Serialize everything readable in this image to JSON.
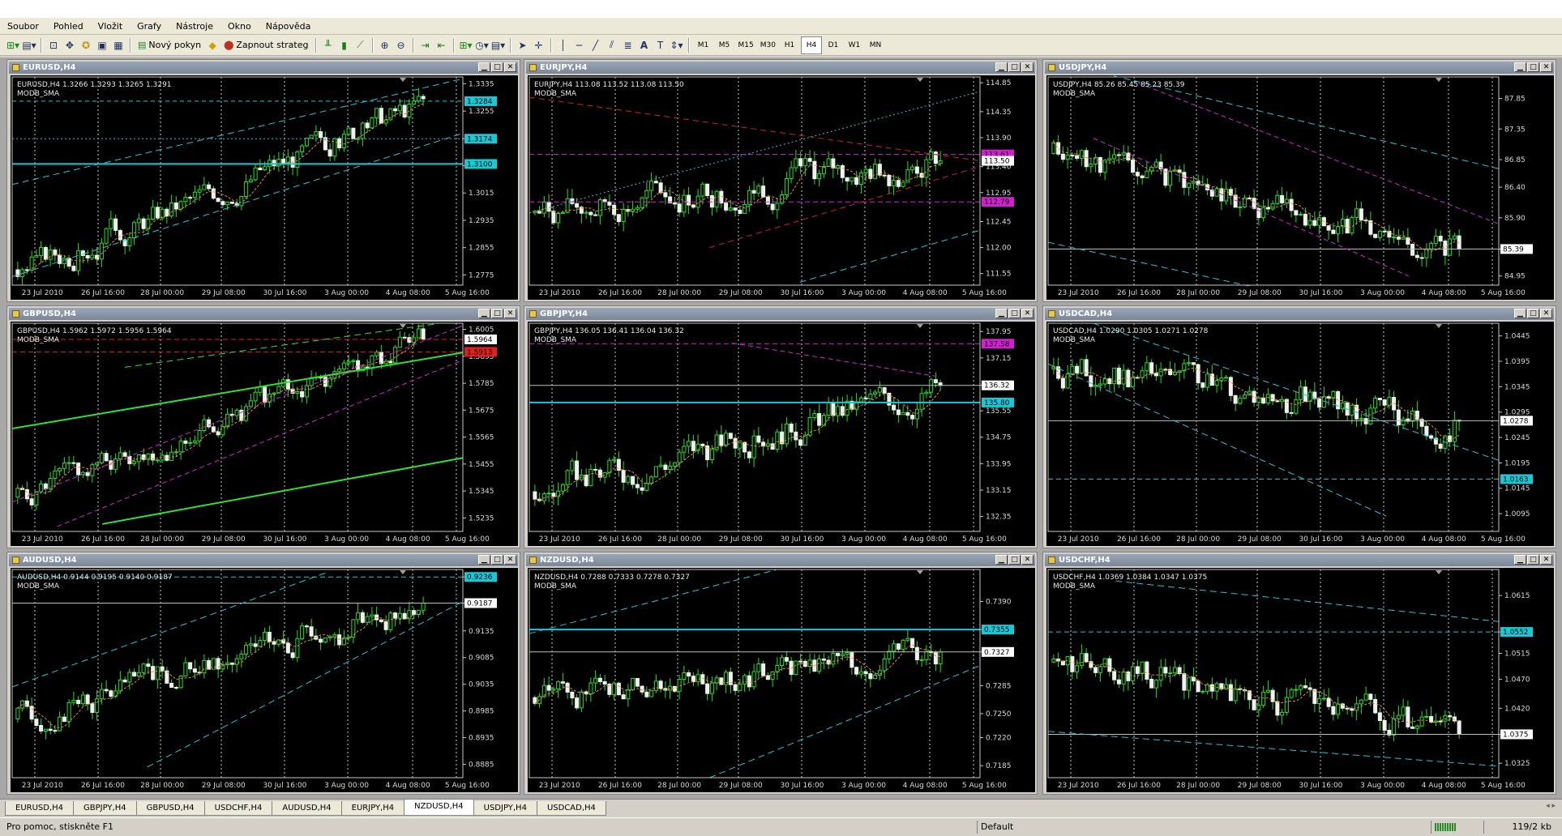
{
  "menu": [
    "Soubor",
    "Pohled",
    "Vložit",
    "Grafy",
    "Nástroje",
    "Okno",
    "Nápověda"
  ],
  "toolbar": {
    "new_order": "Nový pokyn",
    "autotrading": "Zapnout strateg",
    "timeframes": [
      "M1",
      "M5",
      "M15",
      "M30",
      "H1",
      "H4",
      "D1",
      "W1",
      "MN"
    ],
    "active_timeframe": "H4"
  },
  "x_labels": [
    "23 Jul 2010",
    "26 Jul 16:00",
    "28 Jul 00:00",
    "29 Jul 08:00",
    "30 Jul 16:00",
    "3 Aug 00:00",
    "4 Aug 08:00",
    "5 Aug 16:00"
  ],
  "tabs": [
    "EURUSD,H4",
    "GBPJPY,H4",
    "GBPUSD,H4",
    "USDCHF,H4",
    "AUDUSD,H4",
    "EURJPY,H4",
    "NZDUSD,H4",
    "USDJPY,H4",
    "USDCAD,H4"
  ],
  "active_tab": "NZDUSD,H4",
  "status": {
    "help": "Pro pomoc, stiskněte F1",
    "profile": "Default",
    "traffic": "119/2 kb"
  },
  "charts": [
    {
      "title": "EURUSD,H4",
      "info": "EURUSD,H4  1.3266 1.3293 1.3265 1.3291",
      "indicator": "MODB_SMA",
      "ymin": 1.2745,
      "ymax": 1.3355,
      "ticks": [
        "1.3335",
        "1.3255",
        "1.3174",
        "1.3095",
        "1.3015",
        "1.2935",
        "1.2855",
        "1.2775"
      ],
      "start": 1.279,
      "end": 1.3291,
      "vol": 0.0032,
      "seed": 3,
      "lines": [
        {
          "p": [
            [
              0,
              1.3284
            ],
            [
              1,
              1.3284
            ]
          ],
          "c": "#19c8d4",
          "d": "5,4"
        },
        {
          "p": [
            [
              0,
              1.3174
            ],
            [
              1,
              1.3174
            ]
          ],
          "c": "#19c8d4",
          "d": "2,3"
        },
        {
          "p": [
            [
              0,
              1.31
            ],
            [
              1,
              1.31
            ]
          ],
          "c": "#19c8d4",
          "d": "",
          "w": 2
        },
        {
          "p": [
            [
              0,
              1.304
            ],
            [
              1,
              1.335
            ]
          ],
          "c": "#19c8d4",
          "d": "8,5"
        },
        {
          "p": [
            [
              0,
              1.277
            ],
            [
              1,
              1.319
            ]
          ],
          "c": "#19c8d4",
          "d": "8,5"
        }
      ],
      "labels": [
        {
          "t": "1.3284",
          "bg": "#19c8d4"
        },
        {
          "t": "1.3174",
          "bg": "#19c8d4"
        },
        {
          "t": "1.3100",
          "bg": "#19c8d4"
        }
      ]
    },
    {
      "title": "EURJPY,H4",
      "info": "EURJPY,H4  113.08 113.52 113.08 113.50",
      "indicator": "MODB_SMA",
      "ymin": 111.35,
      "ymax": 114.95,
      "ticks": [
        "114.85",
        "114.35",
        "113.90",
        "113.40",
        "112.95",
        "112.45",
        "112.00",
        "111.55"
      ],
      "start": 112.6,
      "end": 113.5,
      "vol": 0.22,
      "seed": 7,
      "lines": [
        {
          "p": [
            [
              0,
              113.61
            ],
            [
              1,
              113.61
            ]
          ],
          "c": "#d020d0",
          "d": "6,4"
        },
        {
          "p": [
            [
              0,
              112.79
            ],
            [
              1,
              112.79
            ]
          ],
          "c": "#d020d0",
          "d": "6,4"
        },
        {
          "p": [
            [
              0,
              114.6
            ],
            [
              1,
              113.5
            ]
          ],
          "c": "#d02020",
          "d": "7,5"
        },
        {
          "p": [
            [
              0.4,
              112.0
            ],
            [
              1,
              113.4
            ]
          ],
          "c": "#d02020",
          "d": "7,5"
        },
        {
          "p": [
            [
              0,
              112.6
            ],
            [
              1,
              114.7
            ]
          ],
          "c": "#19c8d4",
          "d": "2,3"
        },
        {
          "p": [
            [
              0.6,
              111.4
            ],
            [
              1,
              112.3
            ]
          ],
          "c": "#19c8d4",
          "d": "8,5"
        }
      ],
      "labels": [
        {
          "t": "113.61",
          "bg": "#d020d0"
        },
        {
          "t": "113.50",
          "bg": "#ffffff"
        },
        {
          "t": "112.79",
          "bg": "#d020d0"
        }
      ]
    },
    {
      "title": "USDJPY,H4",
      "info": "USDJPY,H4  85.26 85.45 85.23 85.39",
      "indicator": "MODB_SMA",
      "ymin": 84.8,
      "ymax": 88.2,
      "ticks": [
        "87.85",
        "87.35",
        "86.85",
        "86.40",
        "85.90",
        "85.39",
        "84.95"
      ],
      "start": 86.95,
      "end": 85.39,
      "vol": 0.2,
      "seed": 11,
      "lines": [
        {
          "p": [
            [
              0,
              85.39
            ],
            [
              1,
              85.39
            ]
          ],
          "c": "#c0c0c0",
          "d": ""
        },
        {
          "p": [
            [
              0.2,
              88.1
            ],
            [
              1,
              85.8
            ]
          ],
          "c": "#d020d0",
          "d": "6,4"
        },
        {
          "p": [
            [
              0.1,
              87.2
            ],
            [
              0.8,
              84.95
            ]
          ],
          "c": "#d020d0",
          "d": "6,4"
        },
        {
          "p": [
            [
              0.1,
              88.3
            ],
            [
              1,
              86.7
            ]
          ],
          "c": "#19c8d4",
          "d": "8,5"
        },
        {
          "p": [
            [
              0,
              85.5
            ],
            [
              0.5,
              84.7
            ]
          ],
          "c": "#19c8d4",
          "d": "8,5"
        }
      ],
      "labels": [
        {
          "t": "85.39",
          "bg": "#ffffff"
        }
      ]
    },
    {
      "title": "GBPUSD,H4",
      "info": "GBPUSD,H4  1.5962 1.5972 1.5956 1.5964",
      "indicator": "MODB_SMA",
      "ymin": 1.518,
      "ymax": 1.603,
      "ticks": [
        "1.6005",
        "1.5895",
        "1.5785",
        "1.5675",
        "1.5565",
        "1.5455",
        "1.5345",
        "1.5235"
      ],
      "start": 1.532,
      "end": 1.5964,
      "vol": 0.0042,
      "seed": 5,
      "lines": [
        {
          "p": [
            [
              0,
              1.5964
            ],
            [
              1,
              1.5964
            ]
          ],
          "c": "#e02020",
          "d": "6,4"
        },
        {
          "p": [
            [
              0,
              1.5913
            ],
            [
              1,
              1.5913
            ]
          ],
          "c": "#e02020",
          "d": "6,4"
        },
        {
          "p": [
            [
              0,
              1.56
            ],
            [
              1,
              1.591
            ]
          ],
          "c": "#30e030",
          "d": "",
          "w": 2
        },
        {
          "p": [
            [
              0.2,
              1.521
            ],
            [
              1,
              1.548
            ]
          ],
          "c": "#30e030",
          "d": "",
          "w": 2
        },
        {
          "p": [
            [
              0.25,
              1.585
            ],
            [
              0.95,
              1.603
            ]
          ],
          "c": "#30e030",
          "d": "8,5"
        },
        {
          "p": [
            [
              0,
              1.53
            ],
            [
              1,
              1.602
            ]
          ],
          "c": "#d020d0",
          "d": "6,4"
        },
        {
          "p": [
            [
              0.1,
              1.52
            ],
            [
              1,
              1.588
            ]
          ],
          "c": "#d020d0",
          "d": "6,4"
        }
      ],
      "labels": [
        {
          "t": "1.5964",
          "bg": "#ffffff"
        },
        {
          "t": "1.5913",
          "bg": "#e02020"
        }
      ]
    },
    {
      "title": "GBPJPY,H4",
      "info": "GBPJPY,H4  136.05 136.41 136.04 136.32",
      "indicator": "MODB_SMA",
      "ymin": 131.9,
      "ymax": 138.2,
      "ticks": [
        "137.95",
        "137.15",
        "136.32",
        "135.55",
        "134.75",
        "133.95",
        "133.15",
        "132.35"
      ],
      "start": 133.1,
      "end": 136.32,
      "vol": 0.38,
      "seed": 9,
      "lines": [
        {
          "p": [
            [
              0,
              137.58
            ],
            [
              1,
              137.58
            ]
          ],
          "c": "#d020d0",
          "d": "6,4"
        },
        {
          "p": [
            [
              0,
              135.8
            ],
            [
              1,
              135.8
            ]
          ],
          "c": "#19c8d4",
          "d": "",
          "w": 2
        },
        {
          "p": [
            [
              0,
              136.32
            ],
            [
              1,
              136.32
            ]
          ],
          "c": "#c0c0c0",
          "d": ""
        },
        {
          "p": [
            [
              0.45,
              137.6
            ],
            [
              0.9,
              136.6
            ]
          ],
          "c": "#d020d0",
          "d": "6,4"
        }
      ],
      "labels": [
        {
          "t": "137.58",
          "bg": "#d020d0"
        },
        {
          "t": "136.32",
          "bg": "#ffffff"
        },
        {
          "t": "135.80",
          "bg": "#19c8d4"
        }
      ]
    },
    {
      "title": "USDCAD,H4",
      "info": "USDCAD,H4  1.0290 1.0305 1.0271 1.0278",
      "indicator": "MODB_SMA",
      "ymin": 1.006,
      "ymax": 1.047,
      "ticks": [
        "1.0445",
        "1.0395",
        "1.0345",
        "1.0295",
        "1.0245",
        "1.0195",
        "1.0145",
        "1.0095"
      ],
      "start": 1.038,
      "end": 1.0278,
      "vol": 0.0025,
      "seed": 13,
      "lines": [
        {
          "p": [
            [
              0,
              1.0278
            ],
            [
              1,
              1.0278
            ]
          ],
          "c": "#c0c0c0",
          "d": ""
        },
        {
          "p": [
            [
              0,
              1.0163
            ],
            [
              1,
              1.0163
            ]
          ],
          "c": "#19c8d4",
          "d": "6,4"
        },
        {
          "p": [
            [
              0.1,
              1.047
            ],
            [
              1,
              1.02
            ]
          ],
          "c": "#19c8d4",
          "d": "8,5"
        },
        {
          "p": [
            [
              0,
              1.039
            ],
            [
              0.75,
              1.009
            ]
          ],
          "c": "#19c8d4",
          "d": "8,5"
        }
      ],
      "labels": [
        {
          "t": "1.0278",
          "bg": "#ffffff"
        },
        {
          "t": "1.0163",
          "bg": "#19c8d4"
        }
      ]
    },
    {
      "title": "AUDUSD,H4",
      "info": "AUDUSD,H4  0.9144 0.9195 0.9140 0.9187",
      "indicator": "MODB_SMA",
      "ymin": 0.886,
      "ymax": 0.925,
      "ticks": [
        "0.9236",
        "0.9187",
        "0.9135",
        "0.9085",
        "0.9035",
        "0.8985",
        "0.8935",
        "0.8885"
      ],
      "start": 0.897,
      "end": 0.9187,
      "vol": 0.0022,
      "seed": 17,
      "lines": [
        {
          "p": [
            [
              0,
              0.9187
            ],
            [
              1,
              0.9187
            ]
          ],
          "c": "#c0c0c0",
          "d": ""
        },
        {
          "p": [
            [
              0,
              0.9236
            ],
            [
              1,
              0.9236
            ]
          ],
          "c": "#19c8d4",
          "d": "6,4"
        },
        {
          "p": [
            [
              0,
              0.903
            ],
            [
              0.7,
              0.9245
            ]
          ],
          "c": "#19c8d4",
          "d": "8,5"
        },
        {
          "p": [
            [
              0.3,
              0.888
            ],
            [
              1,
              0.919
            ]
          ],
          "c": "#19c8d4",
          "d": "8,5"
        }
      ],
      "labels": [
        {
          "t": "0.9236",
          "bg": "#19c8d4"
        },
        {
          "t": "0.9187",
          "bg": "#ffffff"
        }
      ]
    },
    {
      "title": "NZDUSD,H4",
      "info": "NZDUSD,H4  0.7288 0.7333 0.7278 0.7327",
      "indicator": "MODB_SMA",
      "ymin": 0.717,
      "ymax": 0.743,
      "ticks": [
        "0.7390",
        "0.7355",
        "0.7327",
        "0.7285",
        "0.7250",
        "0.7220",
        "0.7185"
      ],
      "start": 0.727,
      "end": 0.7327,
      "vol": 0.0014,
      "seed": 21,
      "lines": [
        {
          "p": [
            [
              0,
              0.7355
            ],
            [
              1,
              0.7355
            ]
          ],
          "c": "#19c8d4",
          "d": "",
          "w": 2
        },
        {
          "p": [
            [
              0,
              0.7327
            ],
            [
              1,
              0.7327
            ]
          ],
          "c": "#c0c0c0",
          "d": ""
        },
        {
          "p": [
            [
              0,
              0.735
            ],
            [
              0.55,
              0.743
            ]
          ],
          "c": "#19c8d4",
          "d": "8,5"
        },
        {
          "p": [
            [
              0.4,
              0.717
            ],
            [
              1,
              0.731
            ]
          ],
          "c": "#19c8d4",
          "d": "8,5"
        }
      ],
      "labels": [
        {
          "t": "0.7355",
          "bg": "#19c8d4"
        },
        {
          "t": "0.7327",
          "bg": "#ffffff"
        }
      ]
    },
    {
      "title": "USDCHF,H4",
      "info": "USDCHF,H4  1.0369 1.0384 1.0347 1.0375",
      "indicator": "MODB_SMA",
      "ymin": 1.03,
      "ymax": 1.066,
      "ticks": [
        "1.0615",
        "1.0552",
        "1.0515",
        "1.0470",
        "1.0420",
        "1.0375",
        "1.0325"
      ],
      "start": 1.05,
      "end": 1.0375,
      "vol": 0.0022,
      "seed": 25,
      "lines": [
        {
          "p": [
            [
              0,
              1.0375
            ],
            [
              1,
              1.0375
            ]
          ],
          "c": "#c0c0c0",
          "d": ""
        },
        {
          "p": [
            [
              0,
              1.0552
            ],
            [
              1,
              1.0552
            ]
          ],
          "c": "#19c8d4",
          "d": "6,4"
        },
        {
          "p": [
            [
              0.15,
              1.064
            ],
            [
              1,
              1.057
            ]
          ],
          "c": "#19c8d4",
          "d": "8,5"
        },
        {
          "p": [
            [
              0,
              1.038
            ],
            [
              1,
              1.032
            ]
          ],
          "c": "#19c8d4",
          "d": "8,5"
        }
      ],
      "labels": [
        {
          "t": "1.0552",
          "bg": "#19c8d4"
        },
        {
          "t": "1.0375",
          "bg": "#ffffff"
        }
      ]
    }
  ]
}
